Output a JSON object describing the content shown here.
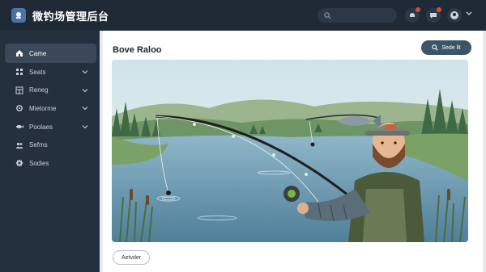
{
  "app": {
    "title": "微钓场管理后台"
  },
  "sidebar": {
    "items": [
      {
        "label": "Came",
        "icon": "home-icon",
        "active": true
      },
      {
        "label": "Seats",
        "icon": "grid-icon",
        "has_submenu": true
      },
      {
        "label": "Reneg",
        "icon": "table-icon",
        "has_submenu": true
      },
      {
        "label": "Mietorme",
        "icon": "gear-icon",
        "has_submenu": true
      },
      {
        "label": "Poolaes",
        "icon": "fish-icon",
        "has_submenu": true
      },
      {
        "label": "Sefms",
        "icon": "people-icon"
      },
      {
        "label": "Sodies",
        "icon": "cog-icon"
      }
    ]
  },
  "main": {
    "title": "Bove Raloo",
    "top_button_label": "Sede llt",
    "bottom_button_label": "Aetvder"
  },
  "colors": {
    "topbar": "#1f2a36",
    "sidebar": "#24303d",
    "active_item": "#3a4859",
    "primary_button": "#3c5468",
    "notification_dot": "#e0483e"
  }
}
